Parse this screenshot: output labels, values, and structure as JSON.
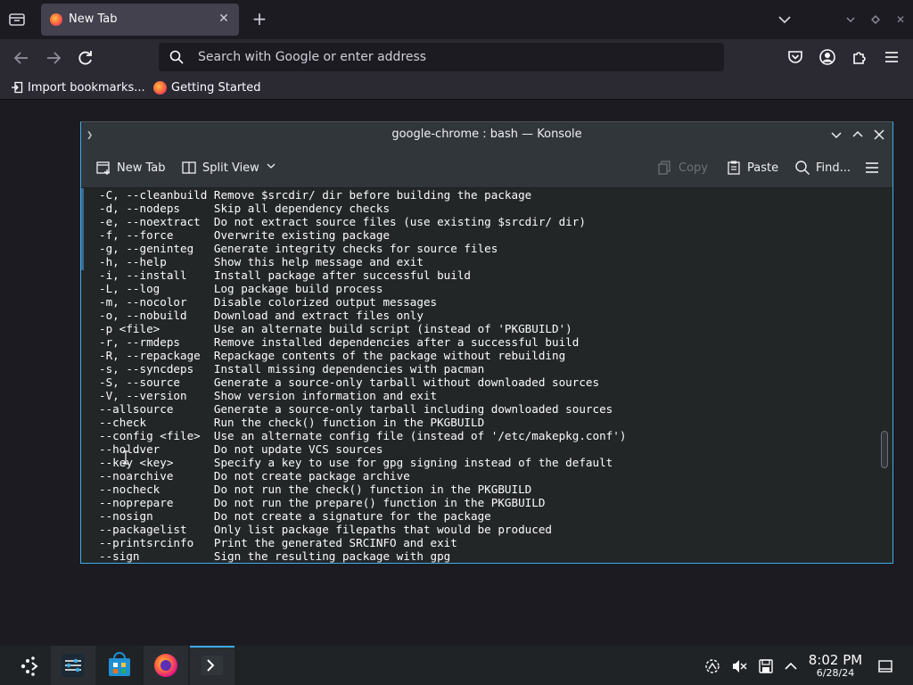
{
  "browser": {
    "tab": {
      "title": "New Tab"
    },
    "urlbar": {
      "placeholder": "Search with Google or enter address"
    },
    "bookmarks": [
      {
        "label": "Import bookmarks..."
      },
      {
        "label": "Getting Started"
      }
    ]
  },
  "konsole": {
    "title": "google-chrome : bash — Konsole",
    "toolbar": {
      "new_tab": "New Tab",
      "split_view": "Split View",
      "copy": "Copy",
      "paste": "Paste",
      "find": "Find..."
    },
    "lines": [
      "-C, --cleanbuild Remove $srcdir/ dir before building the package",
      "-d, --nodeps     Skip all dependency checks",
      "-e, --noextract  Do not extract source files (use existing $srcdir/ dir)",
      "-f, --force      Overwrite existing package",
      "-g, --geninteg   Generate integrity checks for source files",
      "-h, --help       Show this help message and exit",
      "-i, --install    Install package after successful build",
      "-L, --log        Log package build process",
      "-m, --nocolor    Disable colorized output messages",
      "-o, --nobuild    Download and extract files only",
      "-p <file>        Use an alternate build script (instead of 'PKGBUILD')",
      "-r, --rmdeps     Remove installed dependencies after a successful build",
      "-R, --repackage  Repackage contents of the package without rebuilding",
      "-s, --syncdeps   Install missing dependencies with pacman",
      "-S, --source     Generate a source-only tarball without downloaded sources",
      "-V, --version    Show version information and exit",
      "--allsource      Generate a source-only tarball including downloaded sources",
      "--check          Run the check() function in the PKGBUILD",
      "--config <file>  Use an alternate config file (instead of '/etc/makepkg.conf')",
      "--holdver        Do not update VCS sources",
      "--key <key>      Specify a key to use for gpg signing instead of the default",
      "--noarchive      Do not create package archive",
      "--nocheck        Do not run the check() function in the PKGBUILD",
      "--noprepare      Do not run the prepare() function in the PKGBUILD",
      "--nosign         Do not create a signature for the package",
      "--packagelist    Only list package filepaths that would be produced",
      "--printsrcinfo   Print the generated SRCINFO and exit",
      "--sign           Sign the resulting package with gpg"
    ],
    "scroll_position": 0.7
  },
  "taskbar": {
    "time": "8:02 PM",
    "date": "6/28/24"
  },
  "colors": {
    "accent": "#3daee9",
    "firefox_bg": "#1c1b22",
    "terminal_bg": "#232627"
  }
}
